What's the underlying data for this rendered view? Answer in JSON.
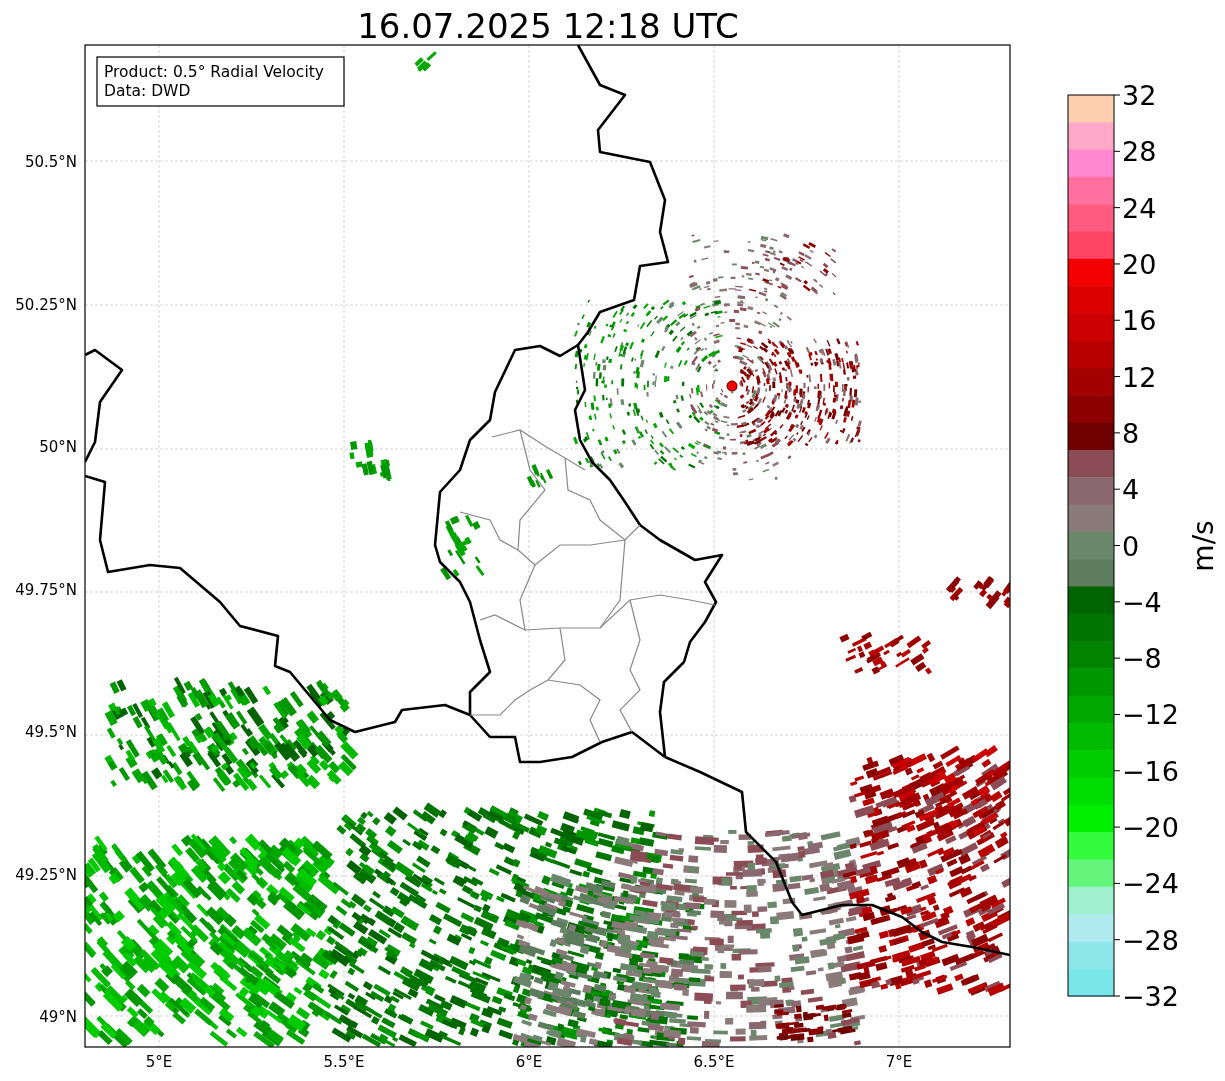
{
  "title": "16.07.2025 12:18 UTC",
  "legend": [
    "Product: 0.5° Radial Velocity",
    "Data: DWD"
  ],
  "y_ticks": [
    "50.5°N",
    "50.25°N",
    "50°N",
    "49.75°N",
    "49.5°N",
    "49.25°N",
    "49°N"
  ],
  "x_ticks": [
    "5°E",
    "5.5°E",
    "6°E",
    "6.5°E",
    "7°E"
  ],
  "colorbar": {
    "label": "m/s",
    "ticks": [
      "32",
      "28",
      "24",
      "20",
      "16",
      "12",
      "8",
      "4",
      "0",
      "−4",
      "−8",
      "−12",
      "−16",
      "−20",
      "−24",
      "−28",
      "−32"
    ],
    "bins": [
      {
        "color": "#ffd0b0"
      },
      {
        "color": "#ffa8c8"
      },
      {
        "color": "#ff88d0"
      },
      {
        "color": "#ff70a0"
      },
      {
        "color": "#ff5a80"
      },
      {
        "color": "#ff4466"
      },
      {
        "color": "#f50000"
      },
      {
        "color": "#dc0000"
      },
      {
        "color": "#cc0000"
      },
      {
        "color": "#b80000"
      },
      {
        "color": "#a30000"
      },
      {
        "color": "#8c0000"
      },
      {
        "color": "#700000"
      },
      {
        "color": "#8c4c55"
      },
      {
        "color": "#8a6870"
      },
      {
        "color": "#8a7a7a"
      },
      {
        "color": "#6b876b"
      },
      {
        "color": "#5d7c5d"
      },
      {
        "color": "#006400"
      },
      {
        "color": "#007400"
      },
      {
        "color": "#008400"
      },
      {
        "color": "#009600"
      },
      {
        "color": "#00a800"
      },
      {
        "color": "#00bb00"
      },
      {
        "color": "#00cc00"
      },
      {
        "color": "#00dd00"
      },
      {
        "color": "#00f000"
      },
      {
        "color": "#33fa3a"
      },
      {
        "color": "#66f57c"
      },
      {
        "color": "#a0f0d0"
      },
      {
        "color": "#b0eaef"
      },
      {
        "color": "#8ee8ea"
      },
      {
        "color": "#7ae6ea"
      }
    ]
  }
}
